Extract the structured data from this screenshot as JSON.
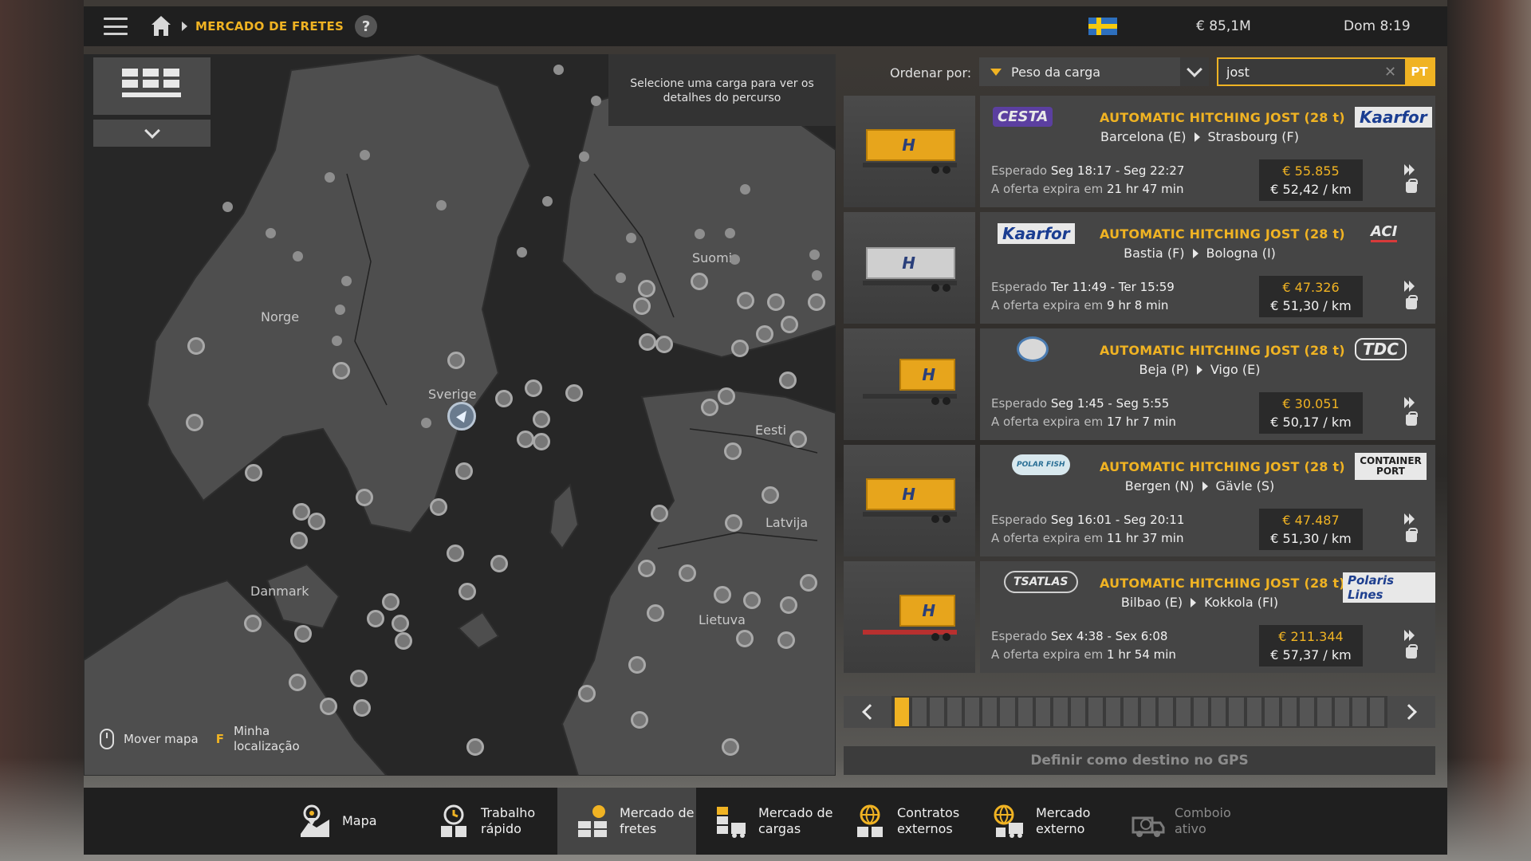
{
  "topbar": {
    "breadcrumb": "MERCADO DE FRETES",
    "help_label": "?",
    "money": "€ 85,1M",
    "clock": "Dom 8:19",
    "flag_colors": [
      "#2d6fbd",
      "#f6c90e"
    ]
  },
  "map": {
    "hint": "Selecione uma carga para ver os detalhes do percurso",
    "countries": [
      "Norge",
      "Sverige",
      "Suomi",
      "Eesti",
      "Latvija",
      "Lietuva",
      "Danmark"
    ],
    "controls": {
      "move_map": "Mover mapa",
      "my_location_key": "F",
      "my_location": "Minha localização"
    }
  },
  "sort": {
    "label": "Ordenar por:",
    "value": "Peso da carga"
  },
  "search": {
    "value": "jost",
    "lang": "PT"
  },
  "jobs": [
    {
      "source_logo": "CESTA",
      "title": "AUTOMATIC HITCHING JOST (28 t)",
      "dest_logo": "Kaarfor",
      "from": "Barcelona (E)",
      "to": "Strasbourg (F)",
      "expected_label": "Esperado",
      "expected": "Seg 18:17 - Seg 22:27",
      "expires_label": "A oferta expira em",
      "expires": "21 hr 47 min",
      "price": "€ 55.855",
      "per_km": "€ 52,42 / km"
    },
    {
      "source_logo": "Kaarfor",
      "title": "AUTOMATIC HITCHING JOST (28 t)",
      "dest_logo": "ACI",
      "from": "Bastia (F)",
      "to": "Bologna (I)",
      "expected_label": "Esperado",
      "expected": "Ter 11:49 - Ter 15:59",
      "expires_label": "A oferta expira em",
      "expires": "9 hr 8 min",
      "price": "€ 47.326",
      "per_km": "€ 51,30 / km"
    },
    {
      "source_logo": "",
      "title": "AUTOMATIC HITCHING JOST (28 t)",
      "dest_logo": "TDC",
      "from": "Beja (P)",
      "to": "Vigo (E)",
      "expected_label": "Esperado",
      "expected": "Seg 1:45 - Seg 5:55",
      "expires_label": "A oferta expira em",
      "expires": "17 hr 7 min",
      "price": "€ 30.051",
      "per_km": "€ 50,17 / km"
    },
    {
      "source_logo": "POLAR FISH",
      "title": "AUTOMATIC HITCHING JOST (28 t)",
      "dest_logo": "CONTAINER PORT",
      "from": "Bergen (N)",
      "to": "Gävle (S)",
      "expected_label": "Esperado",
      "expected": "Seg 16:01 - Seg 20:11",
      "expires_label": "A oferta expira em",
      "expires": "11 hr 37 min",
      "price": "€ 47.487",
      "per_km": "€ 51,30 / km"
    },
    {
      "source_logo": "TSATLAS",
      "title": "AUTOMATIC HITCHING JOST (28 t)",
      "dest_logo": "Polaris Lines",
      "from": "Bilbao (E)",
      "to": "Kokkola (FI)",
      "expected_label": "Esperado",
      "expected": "Sex 4:38 - Sex 6:08",
      "expires_label": "A oferta expira em",
      "expires": "1 hr 54 min",
      "price": "€ 211.344",
      "per_km": "€ 57,37 / km"
    }
  ],
  "gps_button": "Definir como destino no GPS",
  "nav": [
    {
      "label": "Mapa",
      "icon": "map-icon"
    },
    {
      "label": "Trabalho rápido",
      "icon": "quick-job-icon"
    },
    {
      "label": "Mercado de fretes",
      "icon": "freight-market-icon"
    },
    {
      "label": "Mercado de cargas",
      "icon": "cargo-market-icon"
    },
    {
      "label": "Contratos externos",
      "icon": "external-contracts-icon"
    },
    {
      "label": "Mercado externo",
      "icon": "external-market-icon"
    },
    {
      "label": "Comboio ativo",
      "icon": "convoy-icon"
    }
  ],
  "colors": {
    "accent": "#f0b323",
    "panel": "#454545",
    "bar": "#1f1f1f"
  }
}
